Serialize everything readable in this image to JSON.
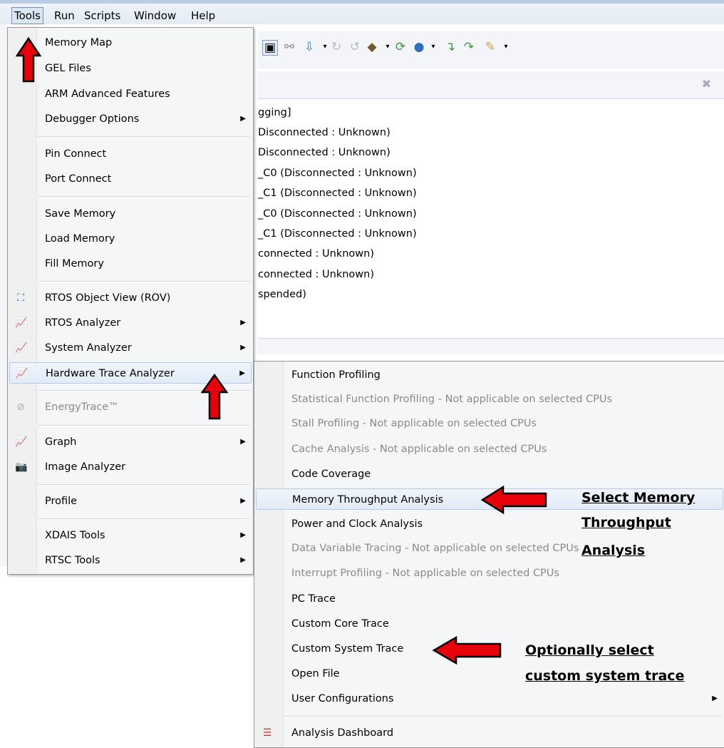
{
  "menubar": {
    "items": [
      "Tools",
      "Run",
      "Scripts",
      "Window",
      "Help"
    ]
  },
  "background": {
    "debug_lines": [
      "gging]",
      "Disconnected : Unknown)",
      "Disconnected : Unknown)",
      "_C0 (Disconnected : Unknown)",
      "_C1 (Disconnected : Unknown)",
      "_C0 (Disconnected : Unknown)",
      "_C1 (Disconnected : Unknown)",
      "connected : Unknown)",
      "connected : Unknown)",
      "spended)"
    ]
  },
  "tools_menu": {
    "items": [
      {
        "label": "Memory Map"
      },
      {
        "label": "GEL Files"
      },
      {
        "label": "ARM Advanced Features"
      },
      {
        "label": "Debugger Options",
        "submenu": true
      },
      {
        "label": "Pin Connect"
      },
      {
        "label": "Port Connect"
      },
      {
        "label": "Save Memory"
      },
      {
        "label": "Load Memory"
      },
      {
        "label": "Fill Memory"
      },
      {
        "label": "RTOS Object View (ROV)",
        "icon": "rov-icon"
      },
      {
        "label": "RTOS Analyzer",
        "submenu": true,
        "icon": "chart-icon"
      },
      {
        "label": "System Analyzer",
        "submenu": true,
        "icon": "chart-icon"
      },
      {
        "label": "Hardware Trace Analyzer",
        "submenu": true,
        "icon": "chart-icon",
        "highlighted": true
      },
      {
        "label": "EnergyTrace™",
        "disabled": true,
        "icon": "no-entry-icon"
      },
      {
        "label": "Graph",
        "submenu": true,
        "icon": "chart-icon"
      },
      {
        "label": "Image Analyzer",
        "icon": "camera-icon"
      },
      {
        "label": "Profile",
        "submenu": true
      },
      {
        "label": "XDAIS Tools",
        "submenu": true
      },
      {
        "label": "RTSC Tools",
        "submenu": true
      }
    ]
  },
  "hw_trace_submenu": {
    "items": [
      {
        "label": "Function Profiling"
      },
      {
        "label": "Statistical Function Profiling - Not applicable on selected CPUs",
        "disabled": true
      },
      {
        "label": "Stall Profiling - Not applicable on selected CPUs",
        "disabled": true
      },
      {
        "label": "Cache Analysis - Not applicable on selected CPUs",
        "disabled": true
      },
      {
        "label": "Code Coverage"
      },
      {
        "label": "Memory Throughput Analysis",
        "highlighted": true
      },
      {
        "label": "Power and Clock Analysis"
      },
      {
        "label": "Data Variable Tracing - Not applicable on selected CPUs",
        "disabled": true
      },
      {
        "label": "Interrupt Profiling - Not applicable on selected CPUs",
        "disabled": true
      },
      {
        "label": "PC Trace"
      },
      {
        "label": "Custom Core Trace"
      },
      {
        "label": "Custom System Trace"
      },
      {
        "label": "Open File"
      },
      {
        "label": "User Configurations",
        "submenu": true
      },
      {
        "label": "Analysis Dashboard",
        "icon": "dashboard-icon"
      }
    ]
  },
  "annotations": {
    "memory_line1": "Select Memory",
    "memory_line2": "Throughput",
    "memory_line3": "Analysis",
    "custom_line1": "Optionally select",
    "custom_line2": "custom system trace"
  },
  "colors": {
    "arrow_red": "#e8000b",
    "highlight": "#dce8f7",
    "disabled_text": "#8a8a8a"
  }
}
